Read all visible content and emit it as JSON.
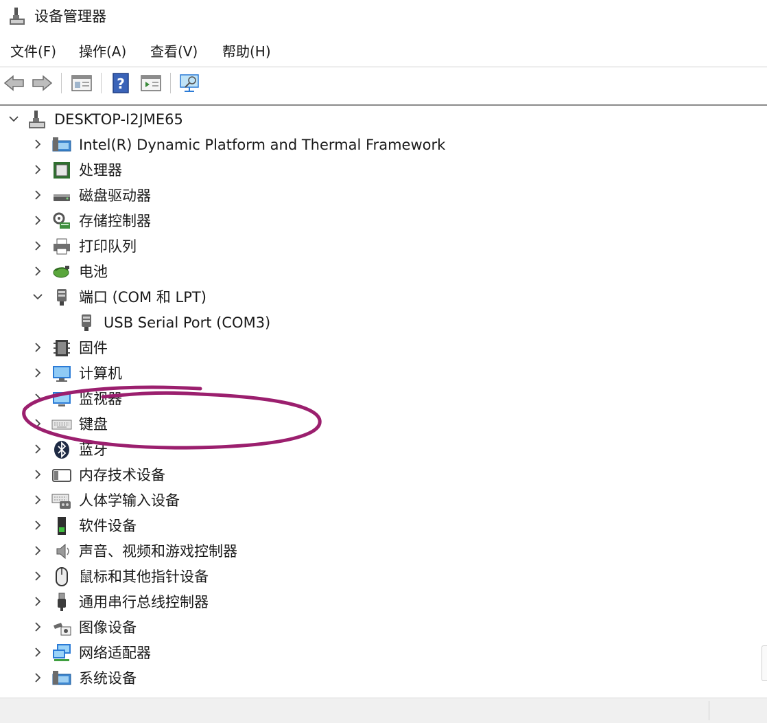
{
  "window": {
    "title": "设备管理器",
    "icon": "device-manager-icon"
  },
  "menu": [
    {
      "label": "文件(F)"
    },
    {
      "label": "操作(A)"
    },
    {
      "label": "查看(V)"
    },
    {
      "label": "帮助(H)"
    }
  ],
  "toolbar": {
    "buttons": [
      "back-arrow-icon",
      "forward-arrow-icon",
      "properties-icon",
      "help-icon",
      "run-icon",
      "scan-hardware-icon"
    ]
  },
  "tree": {
    "root": {
      "label": "DESKTOP-I2JME65",
      "expanded": true,
      "icon": "computer-tower-icon"
    },
    "items": [
      {
        "label": "Intel(R) Dynamic Platform and Thermal Framework",
        "icon": "thermal-framework-icon",
        "expanded": false
      },
      {
        "label": "处理器",
        "icon": "processor-icon",
        "expanded": false
      },
      {
        "label": "磁盘驱动器",
        "icon": "disk-drive-icon",
        "expanded": false
      },
      {
        "label": "存储控制器",
        "icon": "storage-controller-icon",
        "expanded": false
      },
      {
        "label": "打印队列",
        "icon": "printer-icon",
        "expanded": false
      },
      {
        "label": "电池",
        "icon": "battery-icon",
        "expanded": false
      },
      {
        "label": "端口 (COM 和 LPT)",
        "icon": "port-icon",
        "expanded": true,
        "children": [
          {
            "label": "USB Serial Port (COM3)",
            "icon": "serial-port-icon"
          }
        ]
      },
      {
        "label": "固件",
        "icon": "firmware-icon",
        "expanded": false
      },
      {
        "label": "计算机",
        "icon": "computer-icon",
        "expanded": false
      },
      {
        "label": "监视器",
        "icon": "monitor-icon",
        "expanded": false
      },
      {
        "label": "键盘",
        "icon": "keyboard-icon",
        "expanded": false
      },
      {
        "label": "蓝牙",
        "icon": "bluetooth-icon",
        "expanded": false
      },
      {
        "label": "内存技术设备",
        "icon": "memory-tech-icon",
        "expanded": false
      },
      {
        "label": "人体学输入设备",
        "icon": "hid-icon",
        "expanded": false
      },
      {
        "label": "软件设备",
        "icon": "software-device-icon",
        "expanded": false
      },
      {
        "label": "声音、视频和游戏控制器",
        "icon": "speaker-icon",
        "expanded": false
      },
      {
        "label": "鼠标和其他指针设备",
        "icon": "mouse-icon",
        "expanded": false
      },
      {
        "label": "通用串行总线控制器",
        "icon": "usb-icon",
        "expanded": false
      },
      {
        "label": "图像设备",
        "icon": "camera-icon",
        "expanded": false
      },
      {
        "label": "网络适配器",
        "icon": "network-adapter-icon",
        "expanded": false
      },
      {
        "label": "系统设备",
        "icon": "system-device-icon",
        "expanded": false
      }
    ]
  },
  "annotation": {
    "color": "#9b1f6e",
    "target": "端口 (COM 和 LPT)"
  },
  "colors": {
    "accent": "#2b7bd6",
    "background": "#ffffff",
    "statusbar": "#f0f0f0"
  }
}
